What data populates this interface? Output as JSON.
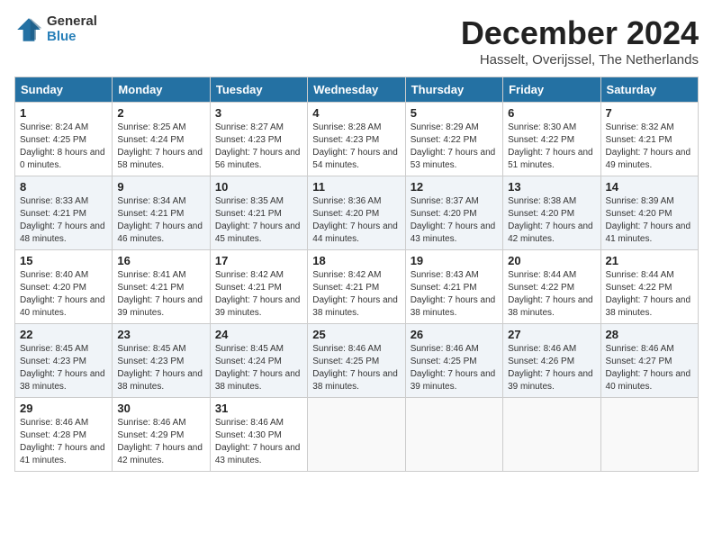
{
  "header": {
    "logo": {
      "general": "General",
      "blue": "Blue"
    },
    "title": "December 2024",
    "location": "Hasselt, Overijssel, The Netherlands"
  },
  "days_of_week": [
    "Sunday",
    "Monday",
    "Tuesday",
    "Wednesday",
    "Thursday",
    "Friday",
    "Saturday"
  ],
  "weeks": [
    [
      {
        "day": "1",
        "sunrise": "Sunrise: 8:24 AM",
        "sunset": "Sunset: 4:25 PM",
        "daylight": "Daylight: 8 hours and 0 minutes."
      },
      {
        "day": "2",
        "sunrise": "Sunrise: 8:25 AM",
        "sunset": "Sunset: 4:24 PM",
        "daylight": "Daylight: 7 hours and 58 minutes."
      },
      {
        "day": "3",
        "sunrise": "Sunrise: 8:27 AM",
        "sunset": "Sunset: 4:23 PM",
        "daylight": "Daylight: 7 hours and 56 minutes."
      },
      {
        "day": "4",
        "sunrise": "Sunrise: 8:28 AM",
        "sunset": "Sunset: 4:23 PM",
        "daylight": "Daylight: 7 hours and 54 minutes."
      },
      {
        "day": "5",
        "sunrise": "Sunrise: 8:29 AM",
        "sunset": "Sunset: 4:22 PM",
        "daylight": "Daylight: 7 hours and 53 minutes."
      },
      {
        "day": "6",
        "sunrise": "Sunrise: 8:30 AM",
        "sunset": "Sunset: 4:22 PM",
        "daylight": "Daylight: 7 hours and 51 minutes."
      },
      {
        "day": "7",
        "sunrise": "Sunrise: 8:32 AM",
        "sunset": "Sunset: 4:21 PM",
        "daylight": "Daylight: 7 hours and 49 minutes."
      }
    ],
    [
      {
        "day": "8",
        "sunrise": "Sunrise: 8:33 AM",
        "sunset": "Sunset: 4:21 PM",
        "daylight": "Daylight: 7 hours and 48 minutes."
      },
      {
        "day": "9",
        "sunrise": "Sunrise: 8:34 AM",
        "sunset": "Sunset: 4:21 PM",
        "daylight": "Daylight: 7 hours and 46 minutes."
      },
      {
        "day": "10",
        "sunrise": "Sunrise: 8:35 AM",
        "sunset": "Sunset: 4:21 PM",
        "daylight": "Daylight: 7 hours and 45 minutes."
      },
      {
        "day": "11",
        "sunrise": "Sunrise: 8:36 AM",
        "sunset": "Sunset: 4:20 PM",
        "daylight": "Daylight: 7 hours and 44 minutes."
      },
      {
        "day": "12",
        "sunrise": "Sunrise: 8:37 AM",
        "sunset": "Sunset: 4:20 PM",
        "daylight": "Daylight: 7 hours and 43 minutes."
      },
      {
        "day": "13",
        "sunrise": "Sunrise: 8:38 AM",
        "sunset": "Sunset: 4:20 PM",
        "daylight": "Daylight: 7 hours and 42 minutes."
      },
      {
        "day": "14",
        "sunrise": "Sunrise: 8:39 AM",
        "sunset": "Sunset: 4:20 PM",
        "daylight": "Daylight: 7 hours and 41 minutes."
      }
    ],
    [
      {
        "day": "15",
        "sunrise": "Sunrise: 8:40 AM",
        "sunset": "Sunset: 4:20 PM",
        "daylight": "Daylight: 7 hours and 40 minutes."
      },
      {
        "day": "16",
        "sunrise": "Sunrise: 8:41 AM",
        "sunset": "Sunset: 4:21 PM",
        "daylight": "Daylight: 7 hours and 39 minutes."
      },
      {
        "day": "17",
        "sunrise": "Sunrise: 8:42 AM",
        "sunset": "Sunset: 4:21 PM",
        "daylight": "Daylight: 7 hours and 39 minutes."
      },
      {
        "day": "18",
        "sunrise": "Sunrise: 8:42 AM",
        "sunset": "Sunset: 4:21 PM",
        "daylight": "Daylight: 7 hours and 38 minutes."
      },
      {
        "day": "19",
        "sunrise": "Sunrise: 8:43 AM",
        "sunset": "Sunset: 4:21 PM",
        "daylight": "Daylight: 7 hours and 38 minutes."
      },
      {
        "day": "20",
        "sunrise": "Sunrise: 8:44 AM",
        "sunset": "Sunset: 4:22 PM",
        "daylight": "Daylight: 7 hours and 38 minutes."
      },
      {
        "day": "21",
        "sunrise": "Sunrise: 8:44 AM",
        "sunset": "Sunset: 4:22 PM",
        "daylight": "Daylight: 7 hours and 38 minutes."
      }
    ],
    [
      {
        "day": "22",
        "sunrise": "Sunrise: 8:45 AM",
        "sunset": "Sunset: 4:23 PM",
        "daylight": "Daylight: 7 hours and 38 minutes."
      },
      {
        "day": "23",
        "sunrise": "Sunrise: 8:45 AM",
        "sunset": "Sunset: 4:23 PM",
        "daylight": "Daylight: 7 hours and 38 minutes."
      },
      {
        "day": "24",
        "sunrise": "Sunrise: 8:45 AM",
        "sunset": "Sunset: 4:24 PM",
        "daylight": "Daylight: 7 hours and 38 minutes."
      },
      {
        "day": "25",
        "sunrise": "Sunrise: 8:46 AM",
        "sunset": "Sunset: 4:25 PM",
        "daylight": "Daylight: 7 hours and 38 minutes."
      },
      {
        "day": "26",
        "sunrise": "Sunrise: 8:46 AM",
        "sunset": "Sunset: 4:25 PM",
        "daylight": "Daylight: 7 hours and 39 minutes."
      },
      {
        "day": "27",
        "sunrise": "Sunrise: 8:46 AM",
        "sunset": "Sunset: 4:26 PM",
        "daylight": "Daylight: 7 hours and 39 minutes."
      },
      {
        "day": "28",
        "sunrise": "Sunrise: 8:46 AM",
        "sunset": "Sunset: 4:27 PM",
        "daylight": "Daylight: 7 hours and 40 minutes."
      }
    ],
    [
      {
        "day": "29",
        "sunrise": "Sunrise: 8:46 AM",
        "sunset": "Sunset: 4:28 PM",
        "daylight": "Daylight: 7 hours and 41 minutes."
      },
      {
        "day": "30",
        "sunrise": "Sunrise: 8:46 AM",
        "sunset": "Sunset: 4:29 PM",
        "daylight": "Daylight: 7 hours and 42 minutes."
      },
      {
        "day": "31",
        "sunrise": "Sunrise: 8:46 AM",
        "sunset": "Sunset: 4:30 PM",
        "daylight": "Daylight: 7 hours and 43 minutes."
      },
      null,
      null,
      null,
      null
    ]
  ]
}
